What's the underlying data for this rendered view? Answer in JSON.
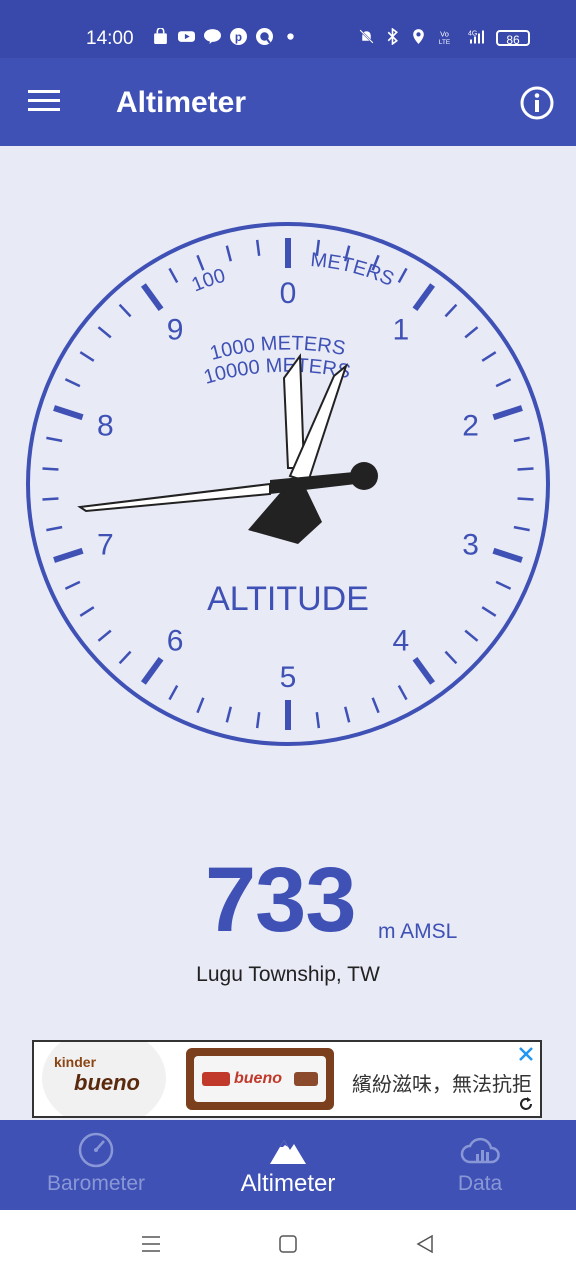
{
  "status_bar": {
    "time": "14:00",
    "battery": "86",
    "left_icons": [
      "shopping-bag-icon",
      "youtube-icon",
      "line-icon",
      "pinterest-icon",
      "quora-icon",
      "dot-icon"
    ],
    "right_icons": [
      "bell-muted-icon",
      "bluetooth-icon",
      "location-icon",
      "volte-icon",
      "signal-4g-icon"
    ]
  },
  "app_bar": {
    "title": "Altimeter",
    "menu_icon": "hamburger-menu-icon",
    "info_icon": "info-icon"
  },
  "gauge": {
    "dial_numbers": [
      "0",
      "1",
      "2",
      "3",
      "4",
      "5",
      "6",
      "7",
      "8",
      "9"
    ],
    "label_100": "100",
    "label_meters_top": "METERS",
    "label_1000": "1000 METERS",
    "label_10000": "10000 METERS",
    "center_label": "ALTITUDE",
    "altitude_value": 733,
    "accent_color": "#3f51b5"
  },
  "reading": {
    "value": "733",
    "unit": "m AMSL",
    "location": "Lugu Township, TW"
  },
  "ad": {
    "brand_small": "kinder",
    "brand_name": "bueno",
    "product_text": "bueno",
    "tagline": "繽紛滋味，無法抗拒"
  },
  "bottom_nav": {
    "items": [
      {
        "label": "Barometer",
        "icon": "gauge-icon",
        "active": false
      },
      {
        "label": "Altimeter",
        "icon": "mountain-icon",
        "active": true
      },
      {
        "label": "Data",
        "icon": "cloud-chart-icon",
        "active": false
      }
    ]
  },
  "system_nav": [
    "recent-apps-icon",
    "home-icon",
    "back-icon"
  ]
}
